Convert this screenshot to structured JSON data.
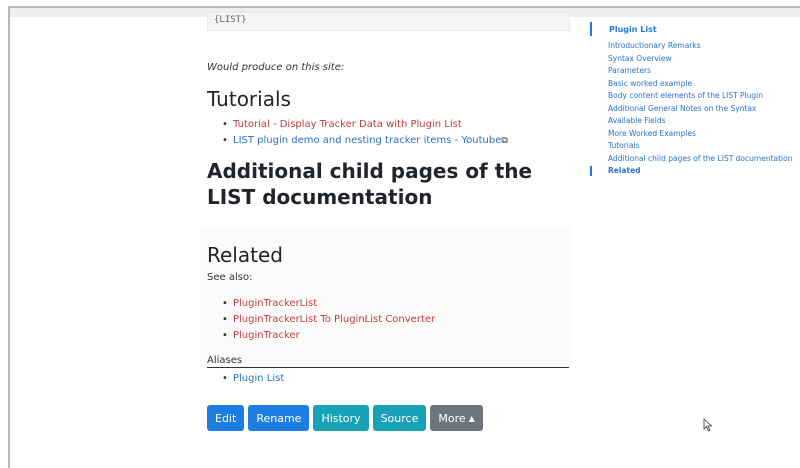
{
  "code_snippet": "{LIST}",
  "produce_text": "Would produce on this site:",
  "tutorials": {
    "heading": "Tutorials",
    "items": [
      {
        "text": "Tutorial - Display Tracker Data with Plugin List",
        "color": "#c13b3b"
      },
      {
        "text": "LIST plugin demo and nesting tracker items - Youtube",
        "color": "#2b73c4",
        "icon": "external-link-icon"
      }
    ]
  },
  "child_heading": "Additional child pages of the LIST documentation",
  "related": {
    "heading": "Related",
    "see_also": "See also:",
    "items": [
      "PluginTrackerList",
      "PluginTrackerList To PluginList Converter",
      "PluginTracker"
    ],
    "aliases_label": "Aliases",
    "aliases": [
      "Plugin List"
    ]
  },
  "buttons": {
    "edit": "Edit",
    "rename": "Rename",
    "history": "History",
    "source": "Source",
    "more": "More"
  },
  "toc": {
    "title": "Plugin List",
    "items": [
      "Introductionary Remarks",
      "Syntax Overview",
      "Parameters",
      "Basic worked example",
      "Body content elements of the LIST Plugin",
      "Additional General Notes on the Syntax",
      "Available Fields",
      "More Worked Examples",
      "Tutorials",
      "Additional child pages of the LIST documentation",
      "Related"
    ]
  },
  "colors": {
    "accent": "#1e7de0",
    "teal": "#17a2b8",
    "grey": "#6c757d",
    "link_red": "#c13b3b"
  }
}
